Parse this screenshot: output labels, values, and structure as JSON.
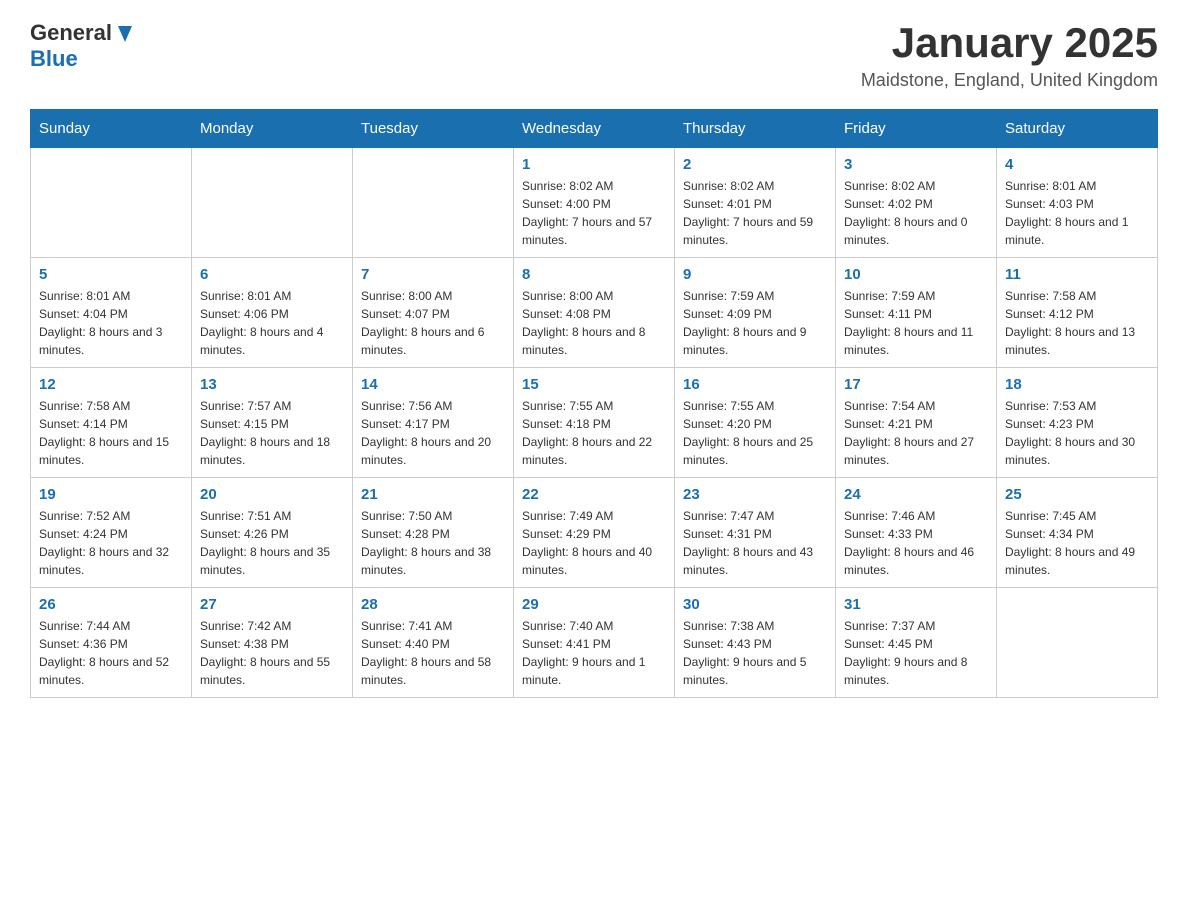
{
  "logo": {
    "general": "General",
    "blue": "Blue"
  },
  "title": "January 2025",
  "subtitle": "Maidstone, England, United Kingdom",
  "weekdays": [
    "Sunday",
    "Monday",
    "Tuesday",
    "Wednesday",
    "Thursday",
    "Friday",
    "Saturday"
  ],
  "weeks": [
    [
      {
        "day": "",
        "info": ""
      },
      {
        "day": "",
        "info": ""
      },
      {
        "day": "",
        "info": ""
      },
      {
        "day": "1",
        "info": "Sunrise: 8:02 AM\nSunset: 4:00 PM\nDaylight: 7 hours and 57 minutes."
      },
      {
        "day": "2",
        "info": "Sunrise: 8:02 AM\nSunset: 4:01 PM\nDaylight: 7 hours and 59 minutes."
      },
      {
        "day": "3",
        "info": "Sunrise: 8:02 AM\nSunset: 4:02 PM\nDaylight: 8 hours and 0 minutes."
      },
      {
        "day": "4",
        "info": "Sunrise: 8:01 AM\nSunset: 4:03 PM\nDaylight: 8 hours and 1 minute."
      }
    ],
    [
      {
        "day": "5",
        "info": "Sunrise: 8:01 AM\nSunset: 4:04 PM\nDaylight: 8 hours and 3 minutes."
      },
      {
        "day": "6",
        "info": "Sunrise: 8:01 AM\nSunset: 4:06 PM\nDaylight: 8 hours and 4 minutes."
      },
      {
        "day": "7",
        "info": "Sunrise: 8:00 AM\nSunset: 4:07 PM\nDaylight: 8 hours and 6 minutes."
      },
      {
        "day": "8",
        "info": "Sunrise: 8:00 AM\nSunset: 4:08 PM\nDaylight: 8 hours and 8 minutes."
      },
      {
        "day": "9",
        "info": "Sunrise: 7:59 AM\nSunset: 4:09 PM\nDaylight: 8 hours and 9 minutes."
      },
      {
        "day": "10",
        "info": "Sunrise: 7:59 AM\nSunset: 4:11 PM\nDaylight: 8 hours and 11 minutes."
      },
      {
        "day": "11",
        "info": "Sunrise: 7:58 AM\nSunset: 4:12 PM\nDaylight: 8 hours and 13 minutes."
      }
    ],
    [
      {
        "day": "12",
        "info": "Sunrise: 7:58 AM\nSunset: 4:14 PM\nDaylight: 8 hours and 15 minutes."
      },
      {
        "day": "13",
        "info": "Sunrise: 7:57 AM\nSunset: 4:15 PM\nDaylight: 8 hours and 18 minutes."
      },
      {
        "day": "14",
        "info": "Sunrise: 7:56 AM\nSunset: 4:17 PM\nDaylight: 8 hours and 20 minutes."
      },
      {
        "day": "15",
        "info": "Sunrise: 7:55 AM\nSunset: 4:18 PM\nDaylight: 8 hours and 22 minutes."
      },
      {
        "day": "16",
        "info": "Sunrise: 7:55 AM\nSunset: 4:20 PM\nDaylight: 8 hours and 25 minutes."
      },
      {
        "day": "17",
        "info": "Sunrise: 7:54 AM\nSunset: 4:21 PM\nDaylight: 8 hours and 27 minutes."
      },
      {
        "day": "18",
        "info": "Sunrise: 7:53 AM\nSunset: 4:23 PM\nDaylight: 8 hours and 30 minutes."
      }
    ],
    [
      {
        "day": "19",
        "info": "Sunrise: 7:52 AM\nSunset: 4:24 PM\nDaylight: 8 hours and 32 minutes."
      },
      {
        "day": "20",
        "info": "Sunrise: 7:51 AM\nSunset: 4:26 PM\nDaylight: 8 hours and 35 minutes."
      },
      {
        "day": "21",
        "info": "Sunrise: 7:50 AM\nSunset: 4:28 PM\nDaylight: 8 hours and 38 minutes."
      },
      {
        "day": "22",
        "info": "Sunrise: 7:49 AM\nSunset: 4:29 PM\nDaylight: 8 hours and 40 minutes."
      },
      {
        "day": "23",
        "info": "Sunrise: 7:47 AM\nSunset: 4:31 PM\nDaylight: 8 hours and 43 minutes."
      },
      {
        "day": "24",
        "info": "Sunrise: 7:46 AM\nSunset: 4:33 PM\nDaylight: 8 hours and 46 minutes."
      },
      {
        "day": "25",
        "info": "Sunrise: 7:45 AM\nSunset: 4:34 PM\nDaylight: 8 hours and 49 minutes."
      }
    ],
    [
      {
        "day": "26",
        "info": "Sunrise: 7:44 AM\nSunset: 4:36 PM\nDaylight: 8 hours and 52 minutes."
      },
      {
        "day": "27",
        "info": "Sunrise: 7:42 AM\nSunset: 4:38 PM\nDaylight: 8 hours and 55 minutes."
      },
      {
        "day": "28",
        "info": "Sunrise: 7:41 AM\nSunset: 4:40 PM\nDaylight: 8 hours and 58 minutes."
      },
      {
        "day": "29",
        "info": "Sunrise: 7:40 AM\nSunset: 4:41 PM\nDaylight: 9 hours and 1 minute."
      },
      {
        "day": "30",
        "info": "Sunrise: 7:38 AM\nSunset: 4:43 PM\nDaylight: 9 hours and 5 minutes."
      },
      {
        "day": "31",
        "info": "Sunrise: 7:37 AM\nSunset: 4:45 PM\nDaylight: 9 hours and 8 minutes."
      },
      {
        "day": "",
        "info": ""
      }
    ]
  ]
}
